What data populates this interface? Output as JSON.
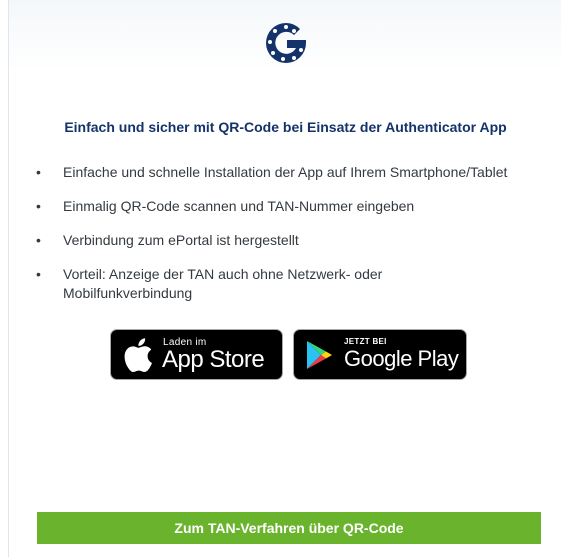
{
  "header": {
    "logo_icon": "g-logo-icon",
    "brand_color": "#14336b"
  },
  "headline": "Einfach und sicher mit QR-Code bei Einsatz der Authenticator App",
  "features": [
    "Einfache und schnelle Installation der App auf Ihrem Smartphone/Tablet",
    "Einmalig QR-Code scannen und TAN-Nummer eingeben",
    "Verbindung zum ePortal ist hergestellt",
    "Vorteil: Anzeige der TAN auch ohne Netzwerk- oder Mobilfunkverbindung"
  ],
  "badges": {
    "app_store": {
      "small": "Laden im",
      "big": "App Store",
      "icon": "apple-icon"
    },
    "google_play": {
      "small": "JETZT BEI",
      "big": "Google Play",
      "icon": "google-play-icon"
    }
  },
  "cta": {
    "label": "Zum TAN-Verfahren über QR-Code",
    "color": "#6ab42d"
  }
}
